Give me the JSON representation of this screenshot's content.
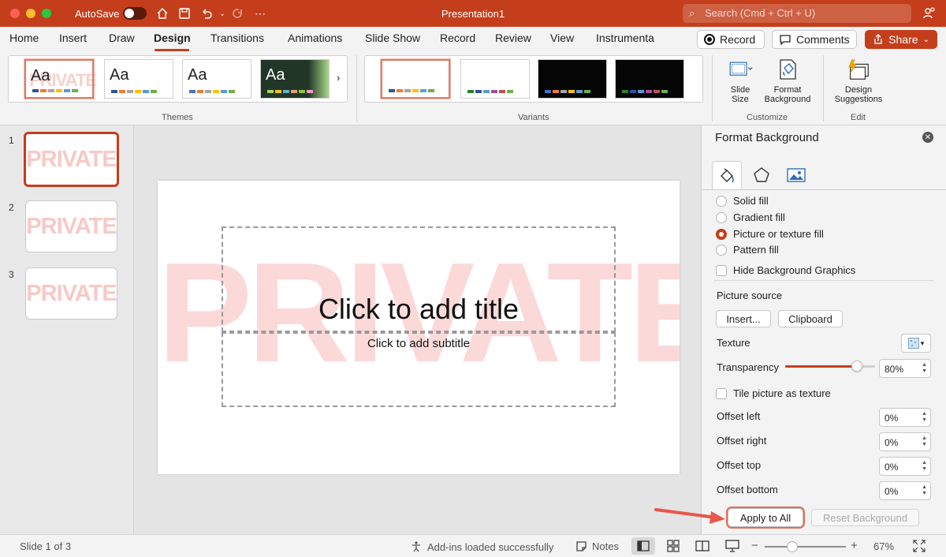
{
  "titlebar": {
    "autosave_label": "AutoSave",
    "doc_title": "Presentation1",
    "search_placeholder": "Search (Cmd + Ctrl + U)",
    "accent": "#c43e1c"
  },
  "menu": {
    "tabs": [
      "Home",
      "Insert",
      "Draw",
      "Design",
      "Transitions",
      "Animations",
      "Slide Show",
      "Record",
      "Review",
      "View",
      "Instrumenta"
    ],
    "active_tab": "Design",
    "record_label": "Record",
    "comments_label": "Comments",
    "share_label": "Share"
  },
  "ribbon": {
    "themes_label": "Themes",
    "variants_label": "Variants",
    "customize_label": "Customize",
    "edit_label": "Edit",
    "theme_thumb_text": "Aa",
    "theme_watermark": "PRIVATE",
    "slide_size": [
      "Slide",
      "Size"
    ],
    "format_background": [
      "Format",
      "Background"
    ],
    "design_suggestions": [
      "Design",
      "Suggestions"
    ]
  },
  "slides": {
    "numbers": [
      "1",
      "2",
      "3"
    ],
    "watermark": "PRIVATE",
    "selected": 1
  },
  "slide": {
    "watermark": "PRIVATE",
    "title_placeholder": "Click to add title",
    "subtitle_placeholder": "Click to add subtitle"
  },
  "format_pane": {
    "title": "Format Background",
    "fill_options": [
      "Solid fill",
      "Gradient fill",
      "Picture or texture fill",
      "Pattern fill"
    ],
    "selected_fill": "Picture or texture fill",
    "hide_bg_graphics": "Hide Background Graphics",
    "picture_source": "Picture source",
    "insert_label": "Insert...",
    "clipboard_label": "Clipboard",
    "texture_label": "Texture",
    "transparency_label": "Transparency",
    "transparency_value": "80%",
    "transparency_fraction": 0.8,
    "tile_label": "Tile picture as texture",
    "offset_left_label": "Offset left",
    "offset_left_value": "0%",
    "offset_right_label": "Offset right",
    "offset_right_value": "0%",
    "offset_top_label": "Offset top",
    "offset_top_value": "0%",
    "offset_bottom_label": "Offset bottom",
    "offset_bottom_value": "0%",
    "apply_all_label": "Apply to All",
    "reset_label": "Reset Background"
  },
  "status": {
    "slide_of": "Slide 1 of 3",
    "addins": "Add-ins loaded successfully",
    "notes": "Notes",
    "zoom_minus": "−",
    "zoom_plus": "+",
    "zoom": "67%"
  }
}
